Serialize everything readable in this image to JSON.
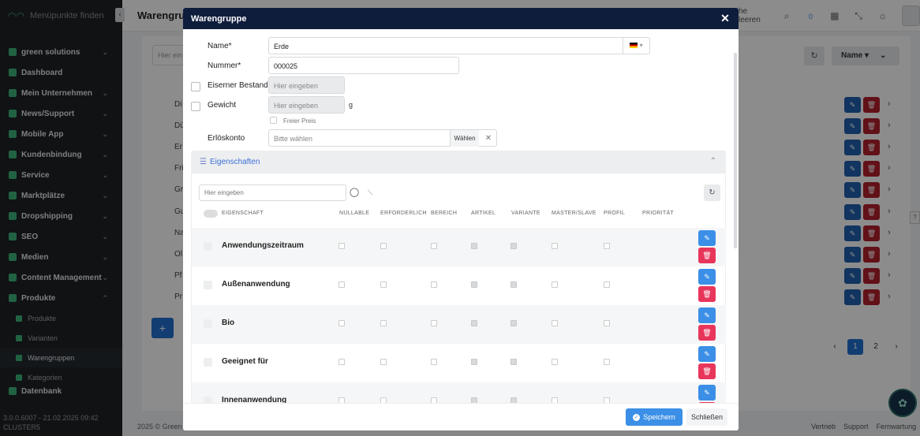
{
  "sidebar": {
    "search_label": "Menüpunkte finden",
    "items": [
      {
        "label": "green solutions"
      },
      {
        "label": "Dashboard"
      },
      {
        "label": "Mein Unternehmen"
      },
      {
        "label": "News/Support"
      },
      {
        "label": "Mobile App"
      },
      {
        "label": "Kundenbindung"
      },
      {
        "label": "Service"
      },
      {
        "label": "Marktplätze"
      },
      {
        "label": "Dropshipping"
      },
      {
        "label": "SEO"
      },
      {
        "label": "Medien"
      },
      {
        "label": "Content Management"
      },
      {
        "label": "Produkte"
      }
    ],
    "subitems": [
      {
        "label": "Produkte"
      },
      {
        "label": "Varianten"
      },
      {
        "label": "Warengruppen"
      },
      {
        "label": "Kategorien"
      }
    ],
    "next_item": "Datenbank",
    "version_line1": "3.0.0.6007 - 21.02.2025 09:42",
    "version_line2": "CLUSTER5"
  },
  "header": {
    "page_title": "Warengrupp",
    "cache_text": "he leeren",
    "notification_count": "0"
  },
  "background": {
    "search_placeholder": "Hier ein",
    "sort_label": "Name",
    "rows": [
      "Di",
      "Dü",
      "Er",
      "Fri",
      "Gr",
      "Gu",
      "Na",
      "Ol",
      "Pf",
      "Pr"
    ],
    "pages": [
      "1",
      "2"
    ],
    "footer_left": "2025 © Green",
    "footer_links": [
      "Vertrieb",
      "Support",
      "Fernwartung"
    ]
  },
  "modal": {
    "title": "Warengruppe",
    "fields": {
      "name_label": "Name*",
      "name_value": "Erde",
      "number_label": "Nummer*",
      "number_value": "000025",
      "bestand_label": "Eiserner Bestand",
      "bestand_placeholder": "Hier eingeben",
      "gewicht_label": "Gewicht",
      "gewicht_placeholder": "Hier eingeben",
      "gewicht_unit": "g",
      "freier_preis_label": "Freier Preis",
      "erloes_label": "Erlöskonto",
      "erloes_placeholder": "Bitte wählen",
      "waehlen_label": "Wählen"
    },
    "section": {
      "title": "Eigenschaften",
      "search_placeholder": "Hier eingeben",
      "columns": [
        "EIGENSCHAFT",
        "NULLABLE",
        "ERFORDERLICH",
        "BEREICH",
        "ARTIKEL",
        "VARIANTE",
        "MASTER/SLAVE",
        "PROFIL",
        "PRIORITÄT"
      ],
      "rows": [
        {
          "name": "Anwendungszeitraum"
        },
        {
          "name": "Außenanwendung"
        },
        {
          "name": "Bio"
        },
        {
          "name": "Geeignet für"
        },
        {
          "name": "Innenanwendung"
        }
      ]
    },
    "footer": {
      "save_label": "Speichern",
      "close_label": "Schließen"
    }
  }
}
